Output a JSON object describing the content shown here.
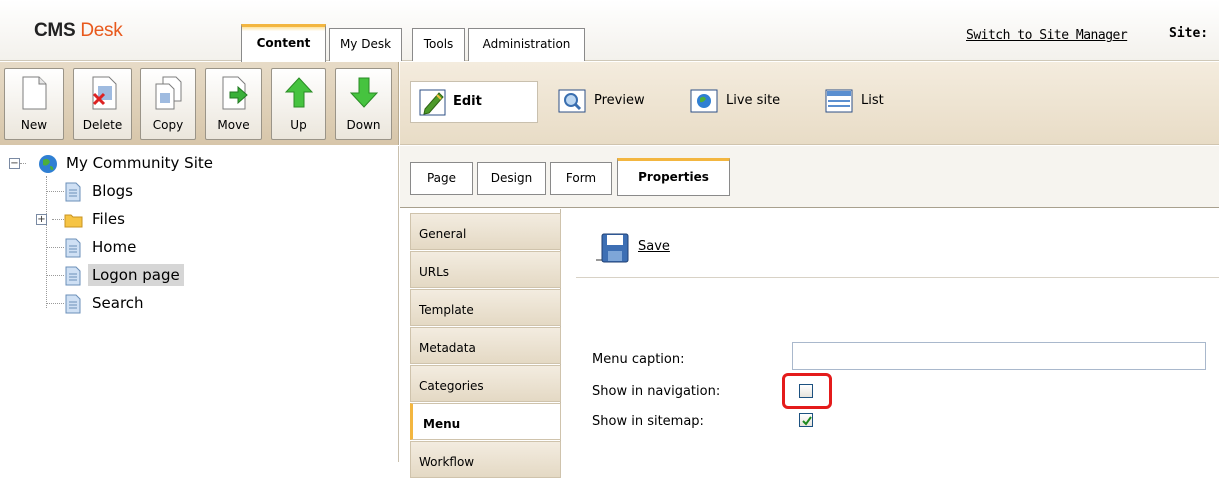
{
  "header": {
    "logo_part1": "CMS",
    "logo_part2": "Desk",
    "tabs": [
      "Content",
      "My Desk",
      "Tools",
      "Administration"
    ],
    "switch_link": "Switch to Site Manager",
    "site_label": "Site:"
  },
  "toolbar": {
    "buttons": [
      "New",
      "Delete",
      "Copy",
      "Move",
      "Up",
      "Down"
    ]
  },
  "view_modes": [
    "Edit",
    "Preview",
    "Live site",
    "List"
  ],
  "tree": {
    "root": "My Community Site",
    "items": [
      "Blogs",
      "Files",
      "Home",
      "Logon page",
      "Search"
    ],
    "selected": "Logon page"
  },
  "content_tabs": [
    "Page",
    "Design",
    "Form",
    "Properties"
  ],
  "properties_nav": [
    "General",
    "URLs",
    "Template",
    "Metadata",
    "Categories",
    "Menu",
    "Workflow"
  ],
  "active_nav": "Menu",
  "form": {
    "save_label": "Save",
    "menu_caption_label": "Menu caption:",
    "menu_caption_value": "",
    "show_in_navigation_label": "Show in navigation:",
    "show_in_navigation_checked": false,
    "show_in_sitemap_label": "Show in sitemap:",
    "show_in_sitemap_checked": true
  },
  "colors": {
    "accent_tab": "#f3b640",
    "logo_orange": "#e8591c",
    "highlight_red": "#e41b1b",
    "toolbar_bg": "#e7dbc7"
  }
}
